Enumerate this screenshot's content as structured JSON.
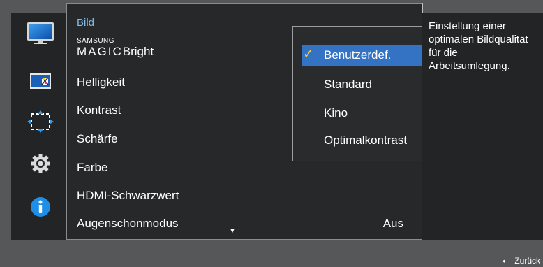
{
  "menu": {
    "title": "Bild",
    "items": [
      {
        "label": "Bright",
        "prefix_small": "SAMSUNG",
        "prefix_big": "MAGIC"
      },
      {
        "label": "Helligkeit"
      },
      {
        "label": "Kontrast"
      },
      {
        "label": "Schärfe"
      },
      {
        "label": "Farbe"
      },
      {
        "label": "HDMI-Schwarzwert"
      },
      {
        "label": "Augenschonmodus",
        "value": "Aus"
      }
    ],
    "scroll_indicator": "▼"
  },
  "submenu": {
    "options": [
      {
        "label": "Benutzerdef.",
        "selected": true
      },
      {
        "label": "Standard"
      },
      {
        "label": "Kino"
      },
      {
        "label": "Optimalkontrast"
      }
    ],
    "check_icon": "✓"
  },
  "sidebar": {
    "icons": [
      "monitor-icon",
      "picture-size-icon",
      "position-icon",
      "settings-gear-icon",
      "info-icon"
    ]
  },
  "help": {
    "text": "Einstellung einer optimalen Bildqualität für die Arbeitsumlegung."
  },
  "footer": {
    "back_label": "Zurück",
    "back_icon": "◄"
  },
  "colors": {
    "accent": "#3473c4",
    "title_blue": "#7fbff0",
    "check_yellow": "#ffd23c",
    "info_blue": "#1e8ee8"
  }
}
